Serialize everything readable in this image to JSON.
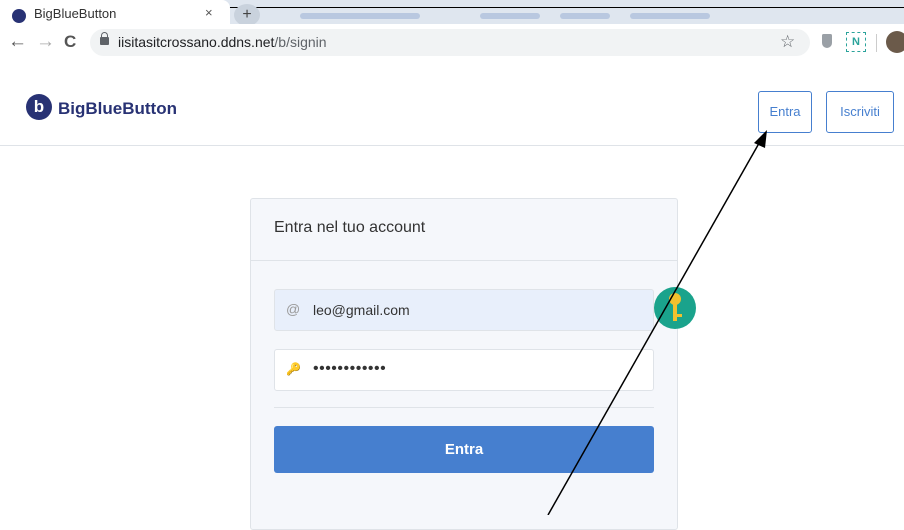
{
  "browser": {
    "tab_title": "BigBlueButton",
    "tab_close": "×",
    "new_tab": "+",
    "url_host": "iisitasitcrossano.ddns.net",
    "url_path": "/b/signin",
    "back": "←",
    "forward": "→",
    "reload": "C",
    "bookmark": "☆",
    "extension_label": "N"
  },
  "header": {
    "logo_letter": "b",
    "logo_text": "BigBlueButton",
    "login_label": "Entra",
    "signup_label": "Iscriviti"
  },
  "signin": {
    "title": "Entra nel tuo account",
    "email_icon": "@",
    "email_value": "leo@gmail.com",
    "password_icon": "🔑",
    "password_mask": "••••••••••••",
    "submit_label": "Entra"
  },
  "colors": {
    "brand": "#283274",
    "primary": "#467fcf",
    "key_badge": "#1aa38c"
  },
  "icons": [
    "lock-icon",
    "star-icon",
    "shield-icon",
    "extension-n-icon",
    "profile-avatar",
    "email-icon",
    "key-icon",
    "password-manager-key-icon"
  ]
}
